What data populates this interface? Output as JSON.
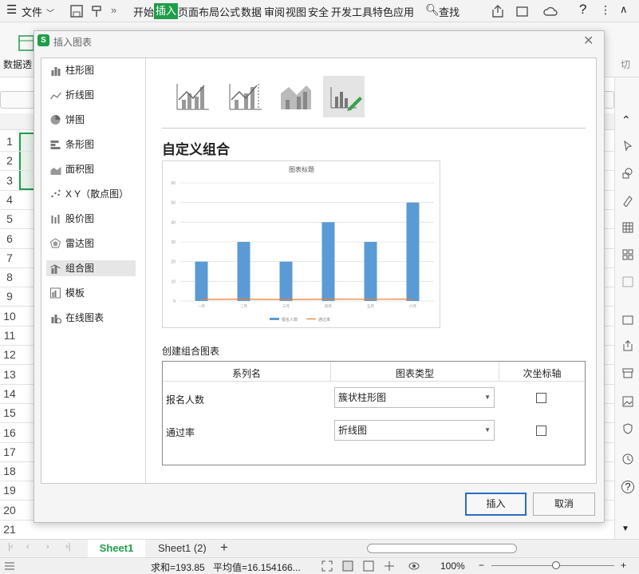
{
  "menubar": {
    "file": "文件",
    "tabs": [
      "开始",
      "插入",
      "页面布局",
      "公式",
      "数据",
      "审阅",
      "视图",
      "安全",
      "开发工具",
      "特色应用"
    ],
    "active_tab": "插入",
    "search": "查找"
  },
  "ribbon": {
    "pivot_label": "数据透",
    "cut_label": "切"
  },
  "sheet": {
    "rows": [
      "1",
      "2",
      "3",
      "4",
      "5",
      "6",
      "7",
      "8",
      "9",
      "10",
      "11",
      "12",
      "13",
      "14",
      "15",
      "16",
      "17",
      "18",
      "19",
      "20",
      "21"
    ]
  },
  "sheet_tabs": {
    "tab1": "Sheet1",
    "tab2": "Sheet1 (2)",
    "add": "+"
  },
  "status": {
    "sum": "求和=193.85",
    "avg": "平均值=16.154166...",
    "zoom": "100%"
  },
  "dialog": {
    "title": "插入图表",
    "categories": [
      "柱形图",
      "折线图",
      "饼图",
      "条形图",
      "面积图",
      "X Y（散点图）",
      "股价图",
      "雷达图",
      "组合图",
      "模板",
      "在线图表"
    ],
    "selected_category": "组合图",
    "section_title": "自定义组合",
    "combo_label": "创建组合图表",
    "table_headers": [
      "系列名",
      "图表类型",
      "次坐标轴"
    ],
    "rows": [
      {
        "name": "报名人数",
        "type": "簇状柱形图",
        "secondary": false
      },
      {
        "name": "通过率",
        "type": "折线图",
        "secondary": false
      }
    ],
    "insert_button": "插入",
    "cancel_button": "取消"
  },
  "colors": {
    "accent": "#1f9e4a",
    "bar": "#5b9bd5",
    "line": "#ed7d31"
  },
  "chart_data": {
    "type": "bar",
    "title": "图表标题",
    "categories": [
      "一月",
      "二月",
      "三月",
      "四月",
      "五月",
      "六月"
    ],
    "series": [
      {
        "name": "报名人数",
        "type": "bar",
        "values": [
          20,
          30,
          20,
          40,
          30,
          50
        ]
      },
      {
        "name": "通过率",
        "type": "line",
        "values": [
          0.8,
          0.85,
          0.75,
          0.9,
          0.88,
          0.92
        ]
      }
    ],
    "ylim": [
      0,
      60
    ],
    "yticks": [
      0,
      10,
      20,
      30,
      40,
      50,
      60
    ],
    "grid": true,
    "legend": "bottom"
  }
}
